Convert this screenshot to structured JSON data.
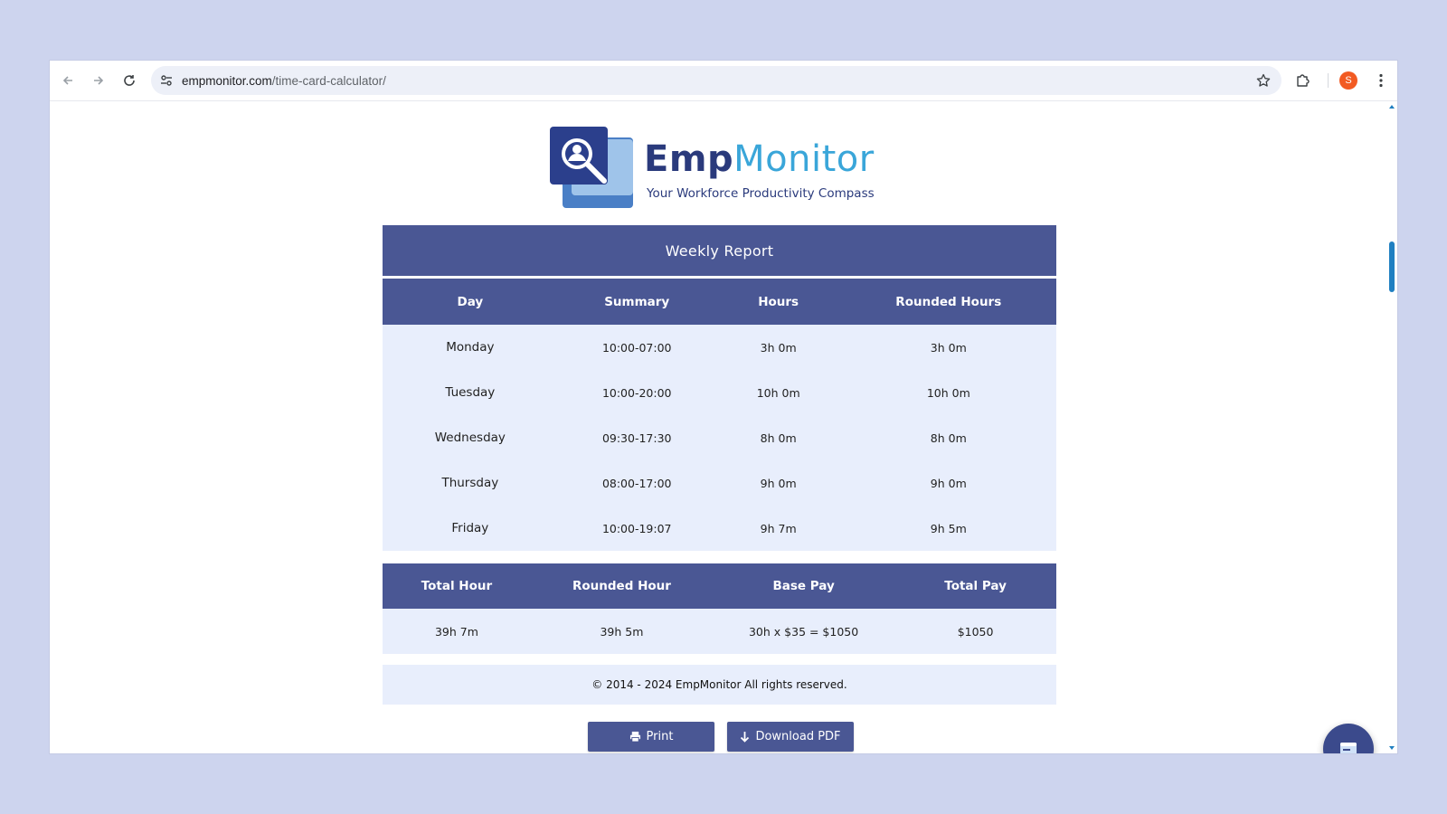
{
  "browser": {
    "url_domain": "empmonitor.com",
    "url_path": "/time-card-calculator/",
    "profile_initial": "S",
    "icons": {
      "back": "arrow-left-icon",
      "forward": "arrow-right-icon",
      "reload": "reload-icon",
      "site_info": "tune-icon",
      "bookmark": "star-icon",
      "extensions": "puzzle-icon",
      "menu": "kebab-menu-icon"
    }
  },
  "logo": {
    "brand_part1": "Emp",
    "brand_part2": "Monitor",
    "tagline": "Your Workforce Productivity Compass"
  },
  "report": {
    "title": "Weekly Report",
    "columns": [
      "Day",
      "Summary",
      "Hours",
      "Rounded Hours"
    ],
    "rows": [
      {
        "day": "Monday",
        "summary": "10:00-07:00",
        "hours": "3h 0m",
        "rounded": "3h 0m"
      },
      {
        "day": "Tuesday",
        "summary": "10:00-20:00",
        "hours": "10h 0m",
        "rounded": "10h 0m"
      },
      {
        "day": "Wednesday",
        "summary": "09:30-17:30",
        "hours": "8h 0m",
        "rounded": "8h 0m"
      },
      {
        "day": "Thursday",
        "summary": "08:00-17:00",
        "hours": "9h 0m",
        "rounded": "9h 0m"
      },
      {
        "day": "Friday",
        "summary": "10:00-19:07",
        "hours": "9h 7m",
        "rounded": "9h 5m"
      }
    ]
  },
  "totals": {
    "columns": [
      "Total Hour",
      "Rounded Hour",
      "Base Pay",
      "Total Pay"
    ],
    "values": [
      "39h 7m",
      "39h 5m",
      "30h x $35 = $1050",
      "$1050"
    ]
  },
  "footer": {
    "copyright": "© 2014 - 2024 EmpMonitor All rights reserved."
  },
  "actions": {
    "print_label": "Print",
    "download_label": "Download PDF"
  },
  "colors": {
    "header_bg": "#4a5794",
    "row_bg": "#e8eefc",
    "page_bg": "#cdd4ee",
    "brand_dark": "#2a3a7c",
    "brand_light": "#3aa6d9"
  }
}
